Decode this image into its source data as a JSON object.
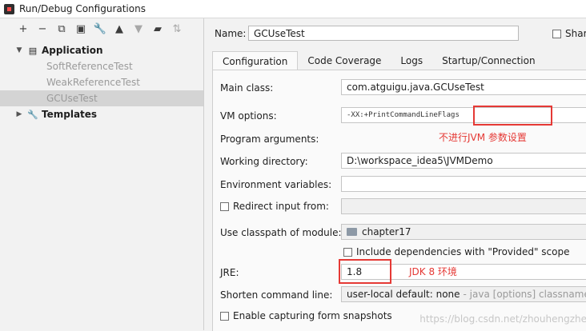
{
  "window": {
    "title": "Run/Debug Configurations"
  },
  "toolbar": {
    "add": "+",
    "remove": "−",
    "copy": "⧉",
    "save": "▣",
    "wrench": "🔧",
    "up": "▲",
    "down": "▼",
    "folder": "▰",
    "sort": "⇅"
  },
  "tree": {
    "application": "Application",
    "children": [
      "SoftReferenceTest",
      "WeakReferenceTest",
      "GCUseTest"
    ],
    "templates": "Templates"
  },
  "name_label": "Name:",
  "name_value": "GCUseTest",
  "share_label": "Shar",
  "tabs": [
    "Configuration",
    "Code Coverage",
    "Logs",
    "Startup/Connection"
  ],
  "form": {
    "main_class_label": "Main class:",
    "main_class_value": "com.atguigu.java.GCUseTest",
    "vm_options_label": "VM options:",
    "vm_options_value": "-XX:+PrintCommandLineFlags",
    "vm_annotation": "不进行JVM 参数设置",
    "program_args_label": "Program arguments:",
    "working_dir_label": "Working directory:",
    "working_dir_value": "D:\\workspace_idea5\\JVMDemo",
    "env_vars_label": "Environment variables:",
    "redirect_label": "Redirect input from:",
    "classpath_label": "Use classpath of module:",
    "classpath_value": "chapter17",
    "include_deps_label": "Include dependencies with \"Provided\" scope",
    "jre_label": "JRE:",
    "jre_value": "1.8",
    "jre_annotation": "JDK 8 环境",
    "shorten_label": "Shorten command line:",
    "shorten_value": "user-local default: none",
    "shorten_hint": "- java [options] classname [ar",
    "capture_label": "Enable capturing form snapshots"
  },
  "watermark": "https://blog.csdn.net/zhouhengzhe",
  "colors": {
    "annotation": "#e53935",
    "selection": "#d4d4d4"
  }
}
